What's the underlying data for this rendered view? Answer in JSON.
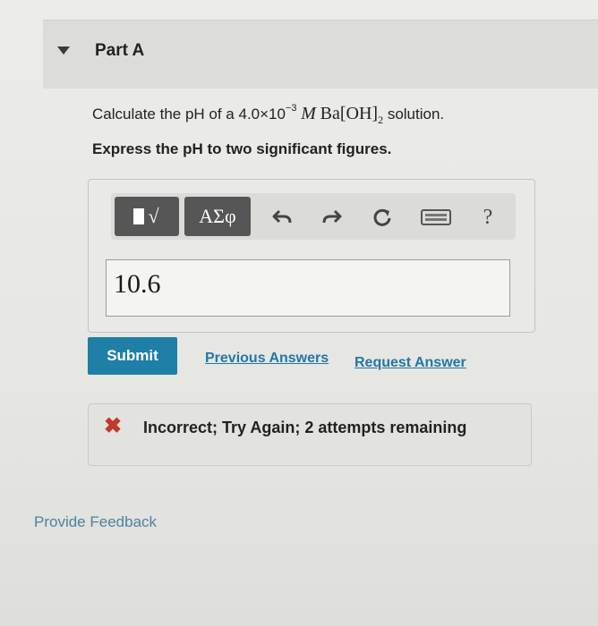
{
  "part": {
    "title": "Part A"
  },
  "question": {
    "prefix": "Calculate the pH of a 4.0×10",
    "exponent": "−3",
    "molarity_unit": "M",
    "formula_base": "Ba[OH]",
    "formula_subscript": "2",
    "suffix": "solution."
  },
  "instruction": "Express the pH to two significant figures.",
  "toolbar": {
    "templates_label": "√",
    "greek_label": "ΑΣφ",
    "help_label": "?"
  },
  "answer": {
    "value": "10.6"
  },
  "actions": {
    "submit_label": "Submit",
    "previous_answers_label": "Previous Answers",
    "request_answer_label": "Request Answer"
  },
  "feedback": {
    "icon": "x-icon",
    "message": "Incorrect; Try Again; 2 attempts remaining",
    "status_color": "#c0392b"
  },
  "footer": {
    "provide_feedback_label": "Provide Feedback"
  },
  "colors": {
    "submit_bg": "#1f7fa6",
    "link": "#2377a8",
    "toolbar_button": "#565656"
  }
}
